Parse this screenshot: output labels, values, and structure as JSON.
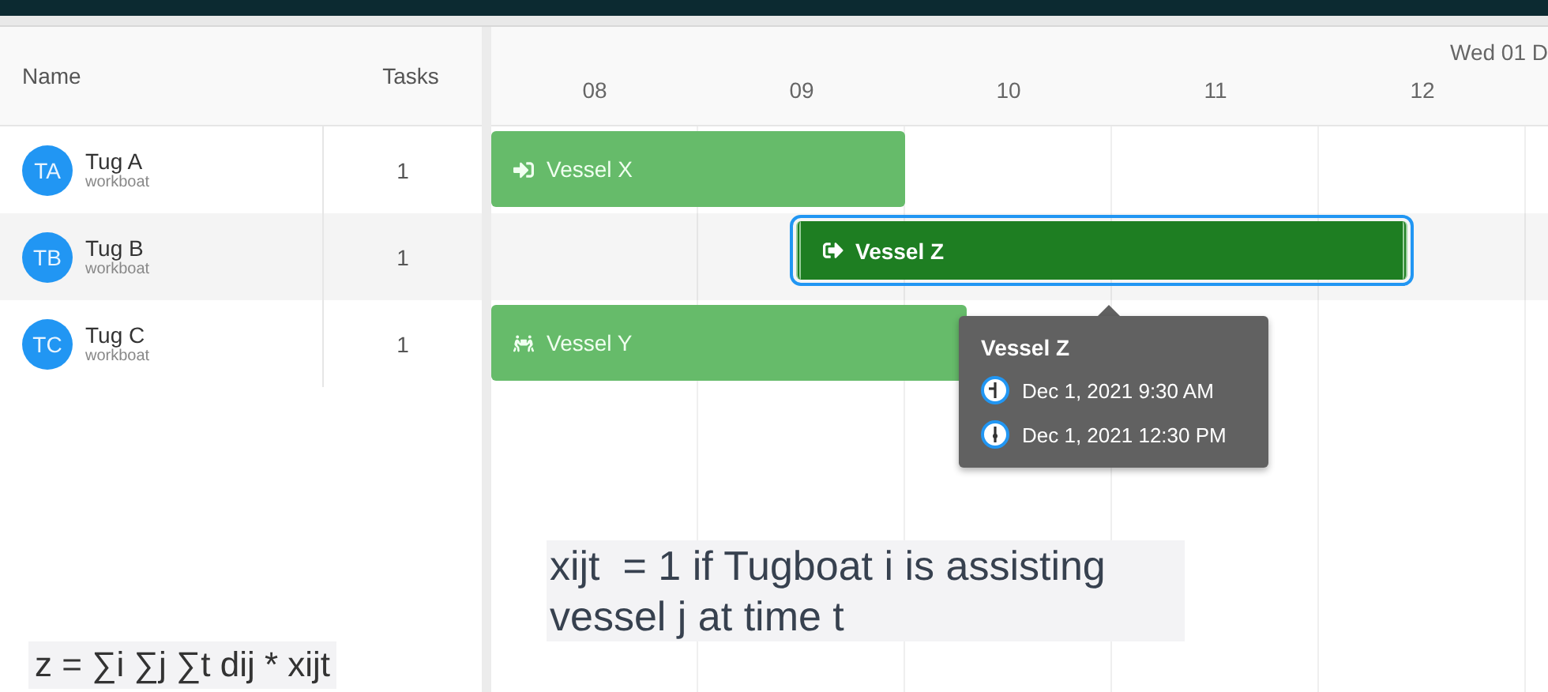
{
  "grid": {
    "columns": [
      "Name",
      "Tasks"
    ]
  },
  "resources": [
    {
      "initials": "TA",
      "name": "Tug A",
      "type": "workboat",
      "tasks": "1",
      "event": {
        "kind": "arrive",
        "name": "Vessel X",
        "selected": false
      }
    },
    {
      "initials": "TB",
      "name": "Tug B",
      "type": "workboat",
      "tasks": "1",
      "event": {
        "kind": "depart",
        "name": "Vessel Z",
        "selected": true
      }
    },
    {
      "initials": "TC",
      "name": "Tug C",
      "type": "workboat",
      "tasks": "1",
      "event": {
        "kind": "assist",
        "name": "Vessel Y",
        "selected": false
      }
    }
  ],
  "timeline": {
    "date": "Wed 01 D",
    "hours": [
      "08",
      "09",
      "10",
      "11",
      "12"
    ]
  },
  "tooltip": {
    "title": "Vessel Z",
    "start": "Dec 1, 2021 9:30 AM",
    "end": "Dec 1, 2021 12:30 PM"
  },
  "notes": [
    "xijt  = 1 if Tugboat i is assisting vessel j at time t",
    "z = ∑i ∑j ∑t dij * xijt"
  ]
}
